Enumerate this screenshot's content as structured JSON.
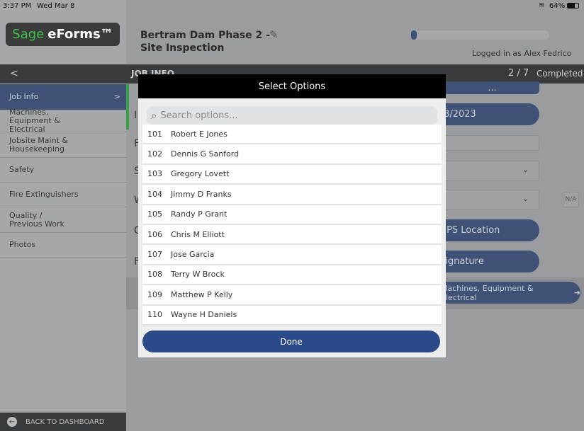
{
  "status": {
    "time": "3:37 PM",
    "date": "Wed Mar 8",
    "battery": "64%"
  },
  "logo": {
    "sage": "Sage",
    "eforms": "eForms™"
  },
  "header": {
    "title_line1": "Bertram Dam Phase 2 -",
    "title_line2": "Site Inspection",
    "logged_in": "Logged in as Alex Fedrico",
    "progress_fraction": 0.015
  },
  "topbar": {
    "back": "<",
    "section": "JOB INFO",
    "page": "2 / 7",
    "completed": "Completed"
  },
  "sidebar": {
    "items": [
      {
        "label": "Job Info",
        "chevron": ">"
      },
      {
        "label": "Machines, Equipment & Electrical"
      },
      {
        "label": "Jobsite Maint & Housekeeping"
      },
      {
        "label": "Safety"
      },
      {
        "label": "Fire Extinguishers"
      },
      {
        "label": "Quality / Previous Work"
      },
      {
        "label": "Photos"
      }
    ],
    "back_to_dashboard": "BACK TO DASHBOARD"
  },
  "form": {
    "date_value": "2/23/2023",
    "gps_label": "GPS Location",
    "signature_label": "Signature",
    "na_label": "N/A",
    "next_label": "Machines, Equipment & Electrical",
    "ellipsis": "...",
    "row_letters": [
      "I",
      "F",
      "S",
      "W",
      "G",
      "F"
    ]
  },
  "modal": {
    "title": "Select Options",
    "search_placeholder": "Search options...",
    "done": "Done",
    "options": [
      {
        "id": "101",
        "name": "Robert E  Jones"
      },
      {
        "id": "102",
        "name": "Dennis G  Sanford"
      },
      {
        "id": "103",
        "name": "Gregory  Lovett"
      },
      {
        "id": "104",
        "name": "Jimmy D  Franks"
      },
      {
        "id": "105",
        "name": "Randy P  Grant"
      },
      {
        "id": "106",
        "name": "Chris M  Elliott"
      },
      {
        "id": "107",
        "name": "Jose  Garcia"
      },
      {
        "id": "108",
        "name": "Terry W  Brock"
      },
      {
        "id": "109",
        "name": "Matthew P  Kelly"
      },
      {
        "id": "110",
        "name": "Wayne H  Daniels"
      }
    ]
  }
}
